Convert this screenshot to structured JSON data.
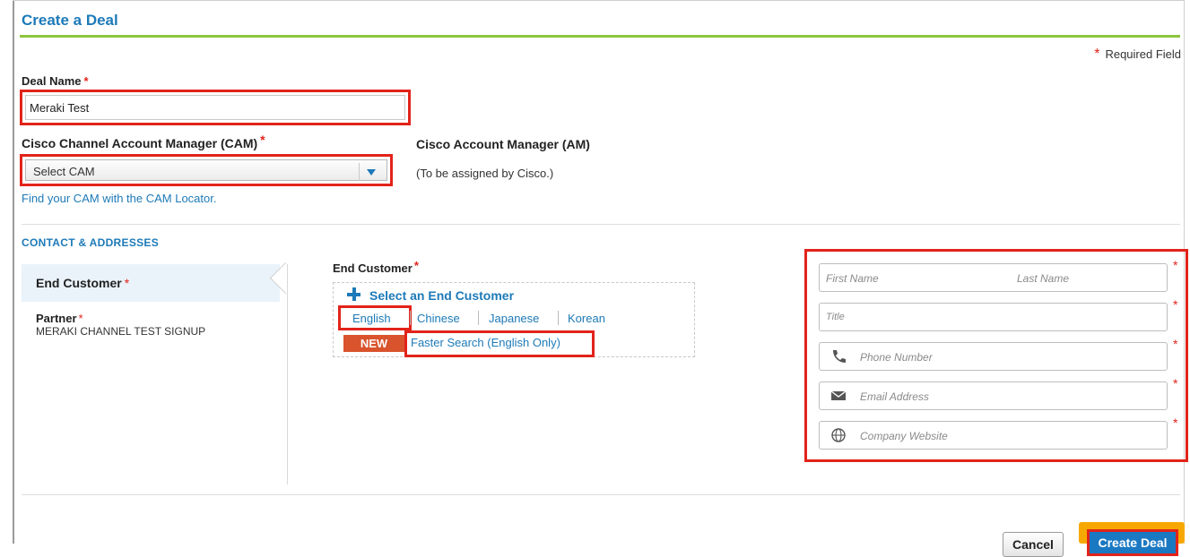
{
  "page": {
    "title": "Create a Deal",
    "required_note": "Required Field",
    "required_marker": "*"
  },
  "deal_name": {
    "label": "Deal Name",
    "value": "Meraki Test"
  },
  "cam": {
    "label": "Cisco Channel Account Manager (CAM)",
    "selected": "Select CAM",
    "locator_link": "Find your CAM with the CAM Locator."
  },
  "am": {
    "label": "Cisco Account Manager (AM)",
    "note": "(To be assigned by Cisco.)"
  },
  "contacts": {
    "section_title": "CONTACT & ADDRESSES",
    "tabs": {
      "end_customer": "End Customer",
      "partner": "Partner",
      "partner_value": "MERAKI CHANNEL TEST SIGNUP"
    },
    "end_customer": {
      "label": "End Customer",
      "select_link": "Select an End Customer",
      "languages": [
        "English",
        "Chinese",
        "Japanese",
        "Korean"
      ],
      "new_badge": "NEW",
      "faster_search": "Faster Search (English Only)"
    },
    "fields": {
      "first_name": "First Name",
      "last_name": "Last Name",
      "title": "Title",
      "phone": "Phone Number",
      "email": "Email Address",
      "website": "Company Website"
    },
    "icons": [
      "phone-icon",
      "envelope-icon",
      "globe-icon"
    ]
  },
  "actions": {
    "cancel": "Cancel",
    "create": "Create Deal"
  },
  "colors": {
    "link_blue": "#1d7ab8",
    "highlight_red": "#e2231a",
    "title_rule_green": "#8cc63f",
    "badge_orange": "#d9532c",
    "focus_orange": "#f7a800",
    "button_blue": "#1b78c2"
  }
}
